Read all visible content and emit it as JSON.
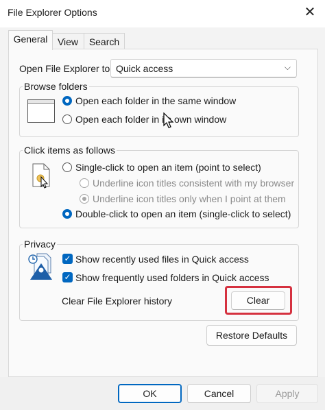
{
  "window": {
    "title": "File Explorer Options",
    "close_glyph": "✕"
  },
  "tabs": [
    {
      "label": "General",
      "active": true
    },
    {
      "label": "View",
      "active": false
    },
    {
      "label": "Search",
      "active": false
    }
  ],
  "open_to": {
    "label": "Open File Explorer to:",
    "value": "Quick access",
    "chevron": "⌵"
  },
  "browse": {
    "title": "Browse folders",
    "options": [
      {
        "label": "Open each folder in the same window",
        "selected": true
      },
      {
        "label": "Open each folder in its own window",
        "selected": false
      }
    ]
  },
  "click": {
    "title": "Click items as follows",
    "options": [
      {
        "label": "Single-click to open an item (point to select)",
        "selected": false,
        "disabled": false
      },
      {
        "label": "Underline icon titles consistent with my browser",
        "selected": false,
        "disabled": true
      },
      {
        "label": "Underline icon titles only when I point at them",
        "selected": true,
        "disabled": true
      },
      {
        "label": "Double-click to open an item (single-click to select)",
        "selected": true,
        "disabled": false
      }
    ]
  },
  "privacy": {
    "title": "Privacy",
    "checks": [
      {
        "label": "Show recently used files in Quick access",
        "checked": true
      },
      {
        "label": "Show frequently used folders in Quick access",
        "checked": true
      }
    ],
    "clear_label": "Clear File Explorer history",
    "clear_button": "Clear",
    "highlight_color": "#d5313f"
  },
  "restore_button": "Restore Defaults",
  "footer": {
    "ok": "OK",
    "cancel": "Cancel",
    "apply": "Apply"
  },
  "colors": {
    "accent": "#0067c0"
  }
}
